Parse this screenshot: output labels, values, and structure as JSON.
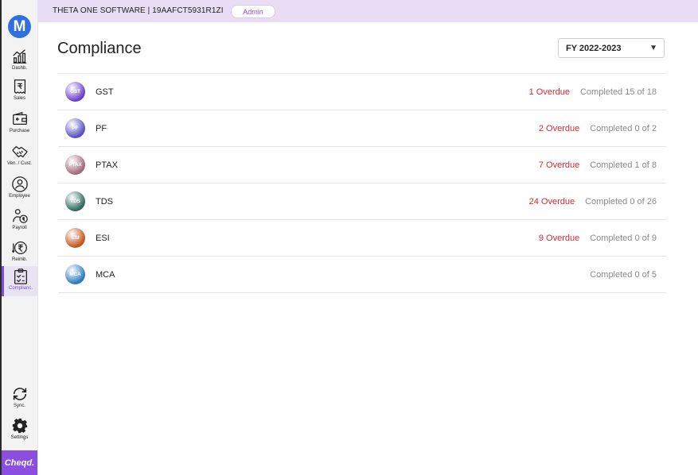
{
  "app": {
    "logo_letter": "M",
    "brand": "Cheqd."
  },
  "sidebar": {
    "items": [
      {
        "label": "Dashb.",
        "icon": "dashboard-chart-icon"
      },
      {
        "label": "Sales",
        "icon": "sales-receipt-icon"
      },
      {
        "label": "Purchase",
        "icon": "purchase-wallet-icon"
      },
      {
        "label": "Ven. / Cust.",
        "icon": "handshake-icon"
      },
      {
        "label": "Employee",
        "icon": "employee-icon"
      },
      {
        "label": "Payroll",
        "icon": "payroll-icon"
      },
      {
        "label": "Reimb.",
        "icon": "rupee-arrows-icon"
      },
      {
        "label": "Complianc.",
        "icon": "clipboard-check-icon"
      }
    ],
    "bottom": [
      {
        "label": "Sync.",
        "icon": "sync-icon"
      },
      {
        "label": "Settings",
        "icon": "gear-icon"
      }
    ],
    "active_color": "#7b4fd6"
  },
  "header": {
    "company": "THETA ONE SOFTWARE | 19AAFCT5931R1ZI",
    "role": "Admin",
    "bg_color": "#e9ddf6"
  },
  "page": {
    "title": "Compliance",
    "fy_selected": "FY 2022-2023"
  },
  "compliance": [
    {
      "name": "GST",
      "badge": "GST",
      "overdue": "1 Overdue",
      "completed": "Completed 15 of 18",
      "color": "#6a3fc8"
    },
    {
      "name": "PF",
      "badge": "PF",
      "overdue": "2 Overdue",
      "completed": "Completed 0 of 2",
      "color": "#5a4fc0"
    },
    {
      "name": "PTAX",
      "badge": "PTAX",
      "overdue": "7 Overdue",
      "completed": "Completed 1 of 8",
      "color": "#a06a7a"
    },
    {
      "name": "TDS",
      "badge": "TDS",
      "overdue": "24 Overdue",
      "completed": "Completed 0 of 26",
      "color": "#2f6a5a"
    },
    {
      "name": "ESI",
      "badge": "ESI",
      "overdue": "9 Overdue",
      "completed": "Completed 0 of 9",
      "color": "#c2541e"
    },
    {
      "name": "MCA",
      "badge": "MCA",
      "overdue": "",
      "completed": "Completed 0 of 5",
      "color": "#2a7ac0"
    }
  ],
  "colors": {
    "overdue": "#d7282f",
    "completed": "#8a8a8a",
    "brand": "#8a4fe0"
  }
}
